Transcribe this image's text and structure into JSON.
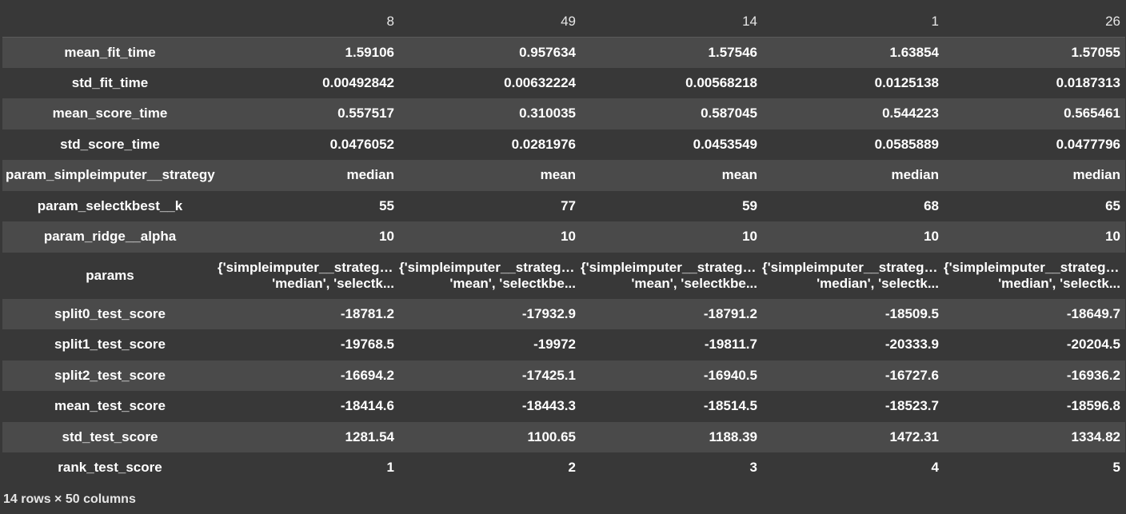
{
  "table": {
    "columns": [
      "8",
      "49",
      "14",
      "1",
      "26"
    ],
    "rows": [
      {
        "label": "mean_fit_time",
        "values": [
          "1.59106",
          "0.957634",
          "1.57546",
          "1.63854",
          "1.57055"
        ]
      },
      {
        "label": "std_fit_time",
        "values": [
          "0.00492842",
          "0.00632224",
          "0.00568218",
          "0.0125138",
          "0.0187313"
        ]
      },
      {
        "label": "mean_score_time",
        "values": [
          "0.557517",
          "0.310035",
          "0.587045",
          "0.544223",
          "0.565461"
        ]
      },
      {
        "label": "std_score_time",
        "values": [
          "0.0476052",
          "0.0281976",
          "0.0453549",
          "0.0585889",
          "0.0477796"
        ]
      },
      {
        "label": "param_simpleimputer__strategy",
        "values": [
          "median",
          "mean",
          "mean",
          "median",
          "median"
        ]
      },
      {
        "label": "param_selectkbest__k",
        "values": [
          "55",
          "77",
          "59",
          "68",
          "65"
        ]
      },
      {
        "label": "param_ridge__alpha",
        "values": [
          "10",
          "10",
          "10",
          "10",
          "10"
        ]
      },
      {
        "label": "params",
        "values": [
          [
            "{'simpleimputer__strategy':",
            "'median', 'selectk..."
          ],
          [
            "{'simpleimputer__strategy':",
            "'mean', 'selectkbe..."
          ],
          [
            "{'simpleimputer__strategy':",
            "'mean', 'selectkbe..."
          ],
          [
            "{'simpleimputer__strategy':",
            "'median', 'selectk..."
          ],
          [
            "{'simpleimputer__strategy':",
            "'median', 'selectk..."
          ]
        ]
      },
      {
        "label": "split0_test_score",
        "values": [
          "-18781.2",
          "-17932.9",
          "-18791.2",
          "-18509.5",
          "-18649.7"
        ]
      },
      {
        "label": "split1_test_score",
        "values": [
          "-19768.5",
          "-19972",
          "-19811.7",
          "-20333.9",
          "-20204.5"
        ]
      },
      {
        "label": "split2_test_score",
        "values": [
          "-16694.2",
          "-17425.1",
          "-16940.5",
          "-16727.6",
          "-16936.2"
        ]
      },
      {
        "label": "mean_test_score",
        "values": [
          "-18414.6",
          "-18443.3",
          "-18514.5",
          "-18523.7",
          "-18596.8"
        ]
      },
      {
        "label": "std_test_score",
        "values": [
          "1281.54",
          "1100.65",
          "1188.39",
          "1472.31",
          "1334.82"
        ]
      },
      {
        "label": "rank_test_score",
        "values": [
          "1",
          "2",
          "3",
          "4",
          "5"
        ]
      }
    ]
  },
  "footer": {
    "shape_text": "14 rows × 50 columns"
  }
}
